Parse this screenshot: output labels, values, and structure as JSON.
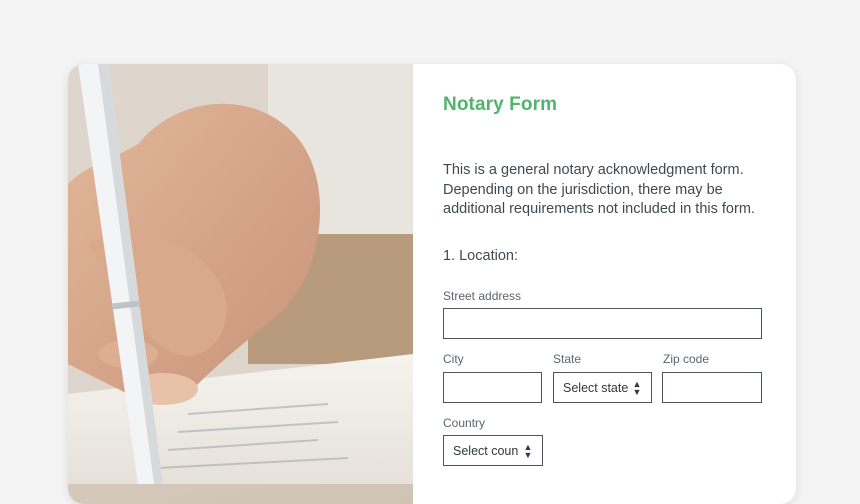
{
  "form": {
    "title": "Notary Form",
    "description": "This is a general notary acknowledgment form. Depending on the jurisdiction, there may be additional requirements not included in this form.",
    "section_location": "1. Location:",
    "street_label": "Street address",
    "street_value": "",
    "city_label": "City",
    "city_value": "",
    "state_label": "State",
    "state_selected": "Select state",
    "zip_label": "Zip code",
    "zip_value": "",
    "country_label": "Country",
    "country_selected": "Select coun"
  },
  "colors": {
    "accent": "#52b36d",
    "text": "#3e4a53",
    "background": "#f4f4f4"
  },
  "icons": {
    "select_arrows": "updown-chevron-icon"
  }
}
